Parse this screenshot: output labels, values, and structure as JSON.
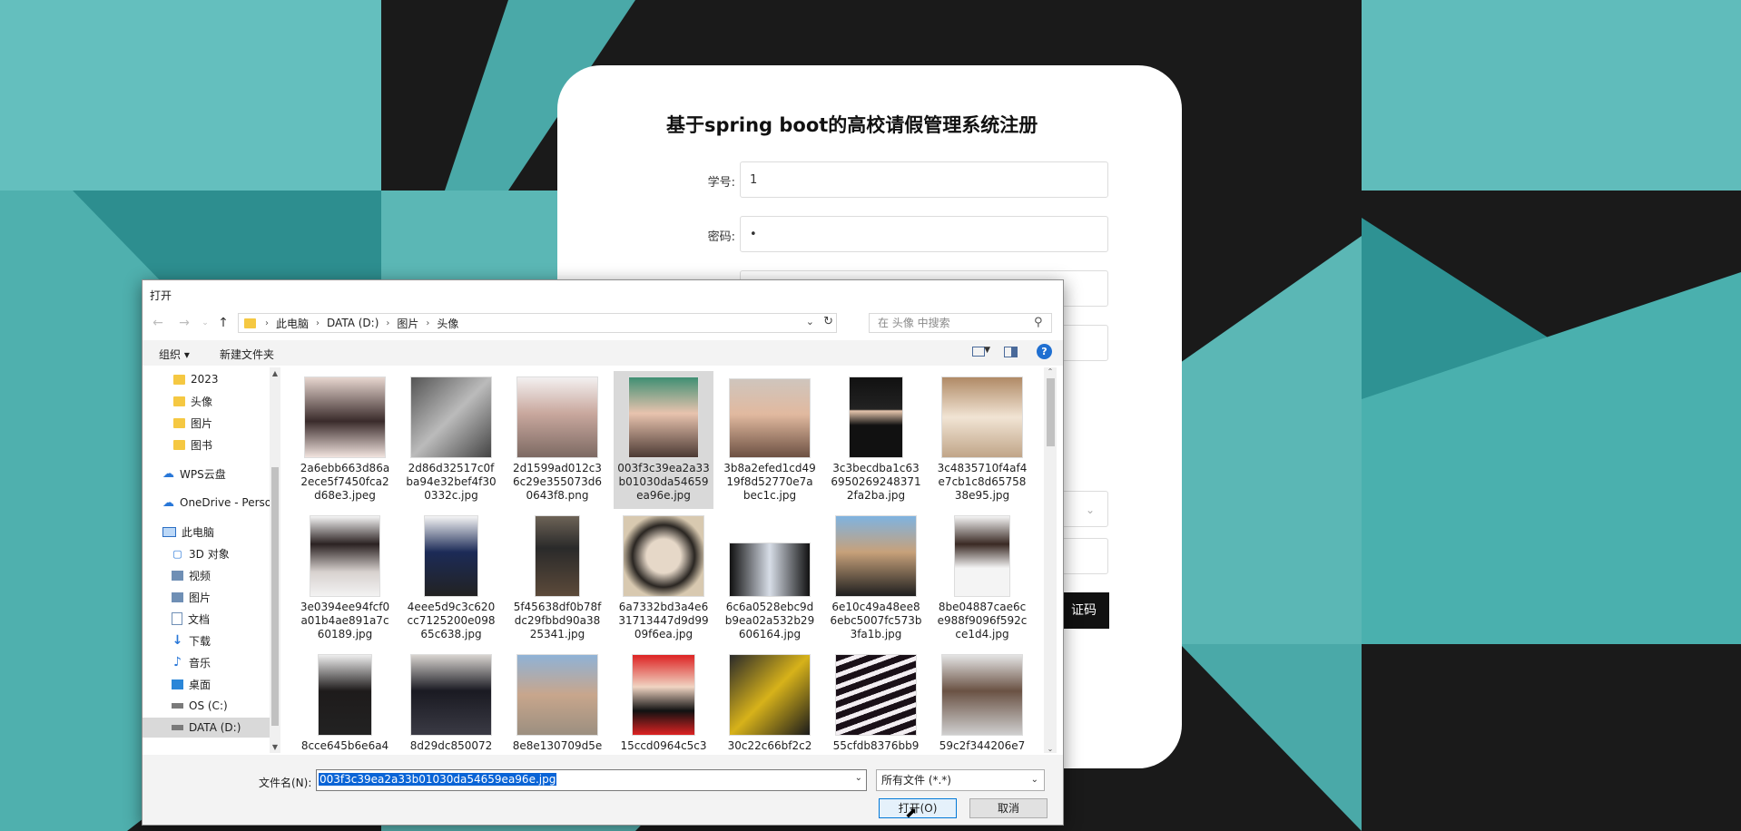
{
  "register_form": {
    "title": "基于spring boot的高校请假管理系统注册",
    "student_id_label": "学号:",
    "student_id_value": "1",
    "password_label": "密码:",
    "password_value": "•",
    "code_button_label": "证码"
  },
  "dialog": {
    "title": "打开",
    "breadcrumb": [
      "此电脑",
      "DATA (D:)",
      "图片",
      "头像"
    ],
    "search_placeholder": "在 头像 中搜索",
    "toolbar": {
      "organize": "组织 ▾",
      "new_folder": "新建文件夹",
      "help": "?"
    },
    "nav_items": [
      {
        "label": "2023",
        "icon": "folder"
      },
      {
        "label": "头像",
        "icon": "folder"
      },
      {
        "label": "图片",
        "icon": "folder"
      },
      {
        "label": "图书",
        "icon": "folder"
      },
      {
        "label": "WPS云盘",
        "icon": "cloud"
      },
      {
        "label": "OneDrive - Person",
        "icon": "cloud"
      },
      {
        "label": "此电脑",
        "icon": "pc"
      },
      {
        "label": "3D 对象",
        "icon": "3d"
      },
      {
        "label": "视频",
        "icon": "video"
      },
      {
        "label": "图片",
        "icon": "pictures"
      },
      {
        "label": "文档",
        "icon": "documents"
      },
      {
        "label": "下载",
        "icon": "download"
      },
      {
        "label": "音乐",
        "icon": "music"
      },
      {
        "label": "桌面",
        "icon": "desktop"
      },
      {
        "label": "OS (C:)",
        "icon": "drive"
      },
      {
        "label": "DATA (D:)",
        "icon": "drive"
      }
    ],
    "files": [
      {
        "name": "2a6ebb663d86a2ece5f7450fca2d68e3.jpeg"
      },
      {
        "name": "2d86d32517c0fba94e32bef4f300332c.jpg"
      },
      {
        "name": "2d1599ad012c36c29e355073d60643f8.png"
      },
      {
        "name": "003f3c39ea2a33b01030da54659ea96e.jpg"
      },
      {
        "name": "3b8a2efed1cd4919f8d52770e7abec1c.jpg"
      },
      {
        "name": "3c3becdba1c636950269248371 2fa2ba.jpg"
      },
      {
        "name": "3c4835710f4af4e7cb1c8d6575838e95.jpg"
      },
      {
        "name": "3e0394ee94fcf0a01b4ae891a7c60189.jpg"
      },
      {
        "name": "4eee5d9c3c620cc7125200e09865c638.jpg"
      },
      {
        "name": "5f45638df0b78fdc29fbbd90a3825341.jpg"
      },
      {
        "name": "6a7332bd3a4e631713447d9d9909f6ea.jpg"
      },
      {
        "name": "6c6a0528ebc9db9ea02a532b29606164.jpg"
      },
      {
        "name": "6e10c49a48ee86ebc5007fc573b3fa1b.jpg"
      },
      {
        "name": "8be04887cae6ce988f9096f592cce1d4.jpg"
      },
      {
        "name": "8cce645b6e6a4"
      },
      {
        "name": "8d29dc850072"
      },
      {
        "name": "8e8e130709d5e"
      },
      {
        "name": "15ccd0964c5c3"
      },
      {
        "name": "30c22c66bf2c2"
      },
      {
        "name": "55cfdb8376bb9"
      },
      {
        "name": "59c2f344206e7"
      }
    ],
    "filename_label": "文件名(N):",
    "filename_value": "003f3c39ea2a33b01030da54659ea96e.jpg",
    "filetype_value": "所有文件 (*.*)",
    "open_button": "打开(O)",
    "cancel_button": "取消"
  }
}
